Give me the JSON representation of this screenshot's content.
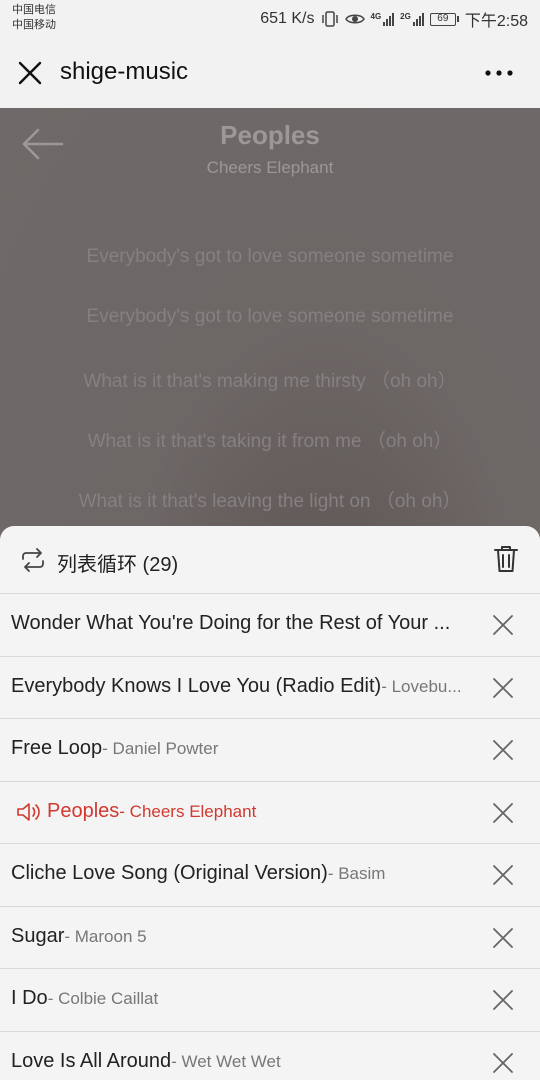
{
  "status_bar": {
    "carrier_1": "中国电信",
    "carrier_2": "中国移动",
    "net_speed": "651 K/s",
    "signal_1_tag": "4G",
    "signal_2_tag": "2G",
    "battery": "69",
    "time": "下午2:58"
  },
  "app_bar": {
    "title": "shige-music"
  },
  "player": {
    "song_title": "Peoples",
    "artist": "Cheers Elephant",
    "lyrics": [
      "Everybody's got to love someone sometime",
      "Everybody's got to love someone sometime",
      "What is it that's making me thirsty  （oh oh）",
      "What is it that's taking it from me  （oh oh）",
      "What is it that's leaving the light on  （oh oh）"
    ]
  },
  "playlist": {
    "mode_label": "列表循环 (29)",
    "items": [
      {
        "title": "Wonder What You're Doing for the Rest of Your ...",
        "artist": ""
      },
      {
        "title": "Everybody Knows I Love You (Radio Edit)",
        "artist": "- Lovebu..."
      },
      {
        "title": "Free Loop",
        "artist": "- Daniel Powter"
      },
      {
        "title": "Peoples",
        "artist": "- Cheers Elephant"
      },
      {
        "title": "Cliche Love Song (Original Version)",
        "artist": "- Basim"
      },
      {
        "title": "Sugar",
        "artist": "- Maroon 5"
      },
      {
        "title": "I Do",
        "artist": "- Colbie Caillat"
      },
      {
        "title": "Love Is All Around",
        "artist": "- Wet Wet Wet"
      }
    ]
  },
  "colors": {
    "accent": "#d0392f",
    "player_bg": "#6e6a69"
  }
}
